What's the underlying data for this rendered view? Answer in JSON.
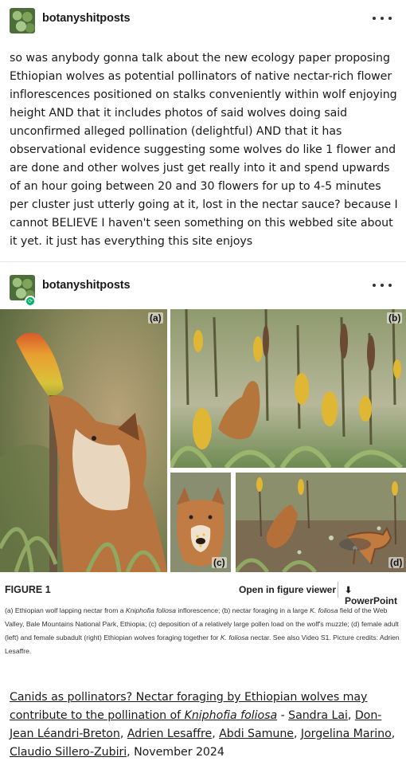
{
  "post1": {
    "username": "botanyshitposts",
    "body": "so was anybody gonna talk about the new ecology paper proposing Ethiopian wolves as potential pollinators of native nectar-rich flower inflorescences positioned on stalks conveniently within wolf enjoying height AND that it includes photos of said wolves doing said unconfirmed alleged pollination (delightful) AND that it has observational evidence suggesting some wolves do like 1 flower and are done and other wolves just get really into it and spend upwards of an hour going between 20 and 30 flowers for up to 4-5 minutes per cluster just utterly going at it, lost in the nectar sauce? because I cannot BELIEVE I haven't seen something on this webbed site about it yet. it just has everything this site enjoys"
  },
  "post2": {
    "username": "botanyshitposts"
  },
  "figure": {
    "panel_labels": [
      "(a)",
      "(b)",
      "(c)",
      "(d)"
    ],
    "title": "FIGURE 1",
    "open_viewer": "Open in figure viewer",
    "powerpoint": "PowerPoint",
    "caption": {
      "p1": "(a) Ethiopian wolf lapping nectar from a ",
      "p1_italic": "Kniphofia foliosa",
      "p2": " inflorescence; (b) nectar foraging in a large ",
      "p2_italic": "K. foliosa",
      "p3": " field of the Web Valley, Bale Mountains National Park, Ethiopia; (c) deposition of a relatively large pollen load on the wolf's muzzle; (d) female adult (left) and female subadult (right) Ethiopian wolves foraging together for ",
      "p3_italic": "K. foliosa",
      "p4": " nectar. See also Video S1. Picture credits: Adrien Lesaffre."
    }
  },
  "citation": {
    "title_part1": "Canids as pollinators? Nectar foraging by Ethiopian wolves may contribute to the pollination of ",
    "title_italic": "Kniphofia foliosa",
    "sep": " - ",
    "authors": [
      "Sandra Lai",
      "Don-Jean Léandri-Breton",
      "Adrien Lesaffre",
      "Abdi Samune",
      "Jorgelina Marino",
      "Claudio Sillero-Zubiri"
    ],
    "comma": ", ",
    "date": ", November 2024"
  },
  "colors": {
    "reblog_green": "#00b26b",
    "text": "#1a1a1a"
  },
  "icons": [
    "avatar-succulent",
    "more-dots-icon",
    "reblog-icon",
    "download-icon"
  ]
}
